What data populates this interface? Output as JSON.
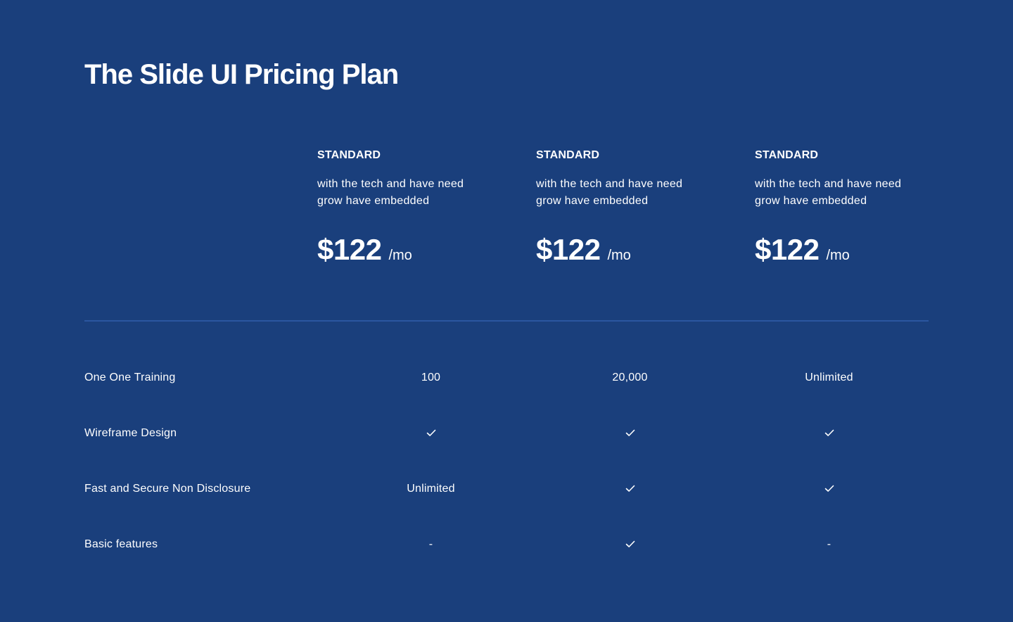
{
  "page": {
    "title": "The Slide UI Pricing Plan"
  },
  "plans": [
    {
      "name": "STANDARD",
      "description": "with the tech and have need grow have embedded",
      "price": "$122",
      "unit": "/mo"
    },
    {
      "name": "STANDARD",
      "description": "with the tech and have need grow have embedded",
      "price": "$122",
      "unit": "/mo"
    },
    {
      "name": "STANDARD",
      "description": "with the tech and have need grow have embedded",
      "price": "$122",
      "unit": "/mo"
    }
  ],
  "features": [
    {
      "label": "One One Training",
      "values": [
        {
          "type": "text",
          "text": "100"
        },
        {
          "type": "text",
          "text": "20,000"
        },
        {
          "type": "text",
          "text": "Unlimited"
        }
      ]
    },
    {
      "label": "Wireframe Design",
      "values": [
        {
          "type": "check",
          "icon": "check-icon"
        },
        {
          "type": "check",
          "icon": "check-icon"
        },
        {
          "type": "check",
          "icon": "check-icon"
        }
      ]
    },
    {
      "label": "Fast and Secure Non Disclosure",
      "values": [
        {
          "type": "text",
          "text": "Unlimited"
        },
        {
          "type": "check",
          "icon": "check-icon"
        },
        {
          "type": "check",
          "icon": "check-icon"
        }
      ]
    },
    {
      "label": "Basic features",
      "values": [
        {
          "type": "text",
          "text": "-"
        },
        {
          "type": "check",
          "icon": "check-icon"
        },
        {
          "type": "text",
          "text": "-"
        }
      ]
    }
  ],
  "colors": {
    "background": "#1a3f7c",
    "text": "#ffffff",
    "divider": "#2b56a0"
  }
}
